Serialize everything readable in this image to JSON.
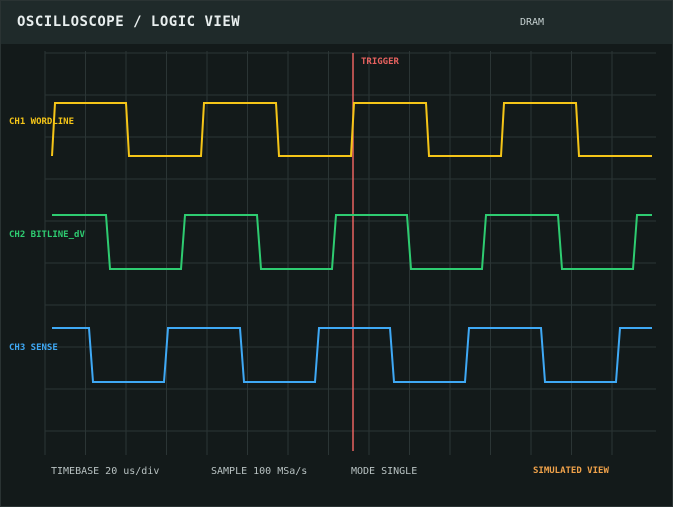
{
  "header": {
    "title": "OSCILLOSCOPE / LOGIC VIEW",
    "badge": "DRAM"
  },
  "trigger": {
    "label": "TRIGGER",
    "color": "#e8625f"
  },
  "channels": [
    {
      "label": "CH1 WORDLINE",
      "color": "#f5c518"
    },
    {
      "label": "CH2 BITLINE_dV",
      "color": "#2ecc71"
    },
    {
      "label": "CH3 SENSE",
      "color": "#3fa9f5"
    }
  ],
  "footer": {
    "timebase": "TIMEBASE  20 us/div",
    "sample": "SAMPLE 100 MSa/s",
    "mode": "MODE SINGLE",
    "status": "SIMULATED VIEW",
    "status_color": "#f0a24a"
  }
}
